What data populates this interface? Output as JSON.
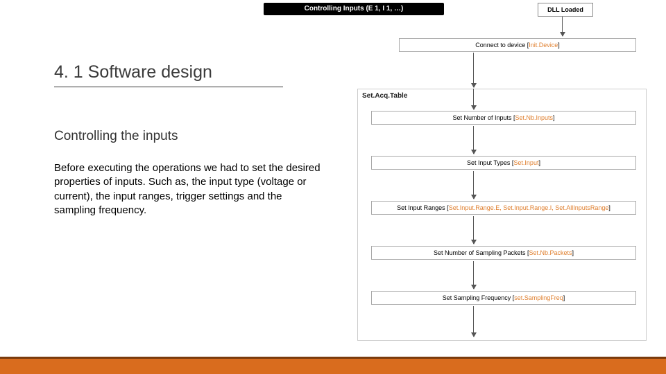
{
  "left": {
    "heading": "4. 1 Software design",
    "subheading": "Controlling the inputs",
    "body": "Before executing the operations we had to set the desired properties of inputs. Such as, the input type (voltage or current), the input ranges, trigger settings and the sampling frequency."
  },
  "diagram": {
    "title": "Controlling Inputs (E 1, I 1, …)",
    "dll": "DLL Loaded",
    "connect_pre": "Connect to device [",
    "connect_fn": "Init.Device",
    "connect_post": "]",
    "section": "Set.Acq.Table",
    "box1_pre": "Set Number of Inputs [",
    "box1_fn": "Set.Nb.Inputs",
    "box1_post": "]",
    "box2_pre": "Set Input Types [",
    "box2_fn": "Set.Input",
    "box2_post": "]",
    "box3_pre": "Set Input Ranges [",
    "box3_fn": "Set.Input.Range.E, Set.Input.Range.I, Set.AllInputsRange",
    "box3_post": "]",
    "box4_pre": "Set Number of Sampling Packets [",
    "box4_fn": "Set.Nb.Packets",
    "box4_post": "]",
    "box5_pre": "Set Sampling Frequency [",
    "box5_fn": "set.SamplingFreq",
    "box5_post": "]"
  }
}
